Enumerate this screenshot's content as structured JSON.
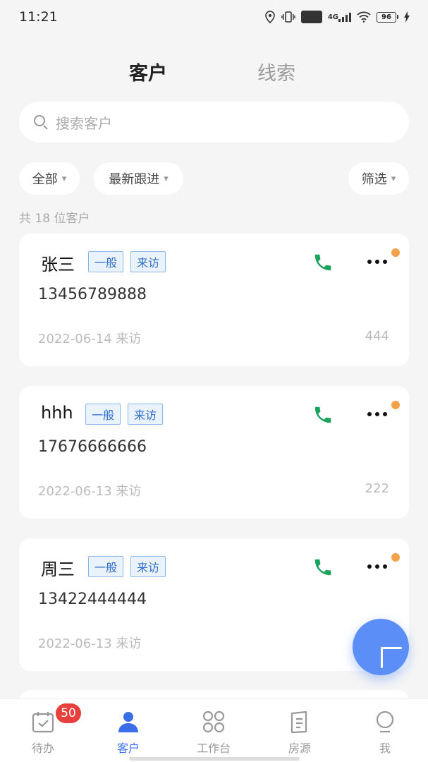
{
  "status": {
    "time": "11:21",
    "hd": "HD",
    "network": "4G",
    "battery": "96"
  },
  "tabs": {
    "customer": "客户",
    "clues": "线索"
  },
  "search": {
    "placeholder": "搜索客户"
  },
  "filters": {
    "all": "全部",
    "latest": "最新跟进",
    "screen": "筛选",
    "caret": "▾"
  },
  "summary": {
    "count_text": "共 18 位客户"
  },
  "customers": [
    {
      "name": "张三",
      "tags": [
        "一般",
        "来访"
      ],
      "phone": "13456789888",
      "date_visit": "2022-06-14 来访",
      "number": "444"
    },
    {
      "name": "hhh",
      "tags": [
        "一般",
        "来访"
      ],
      "phone": "17676666666",
      "date_visit": "2022-06-13 来访",
      "number": "222"
    },
    {
      "name": "周三",
      "tags": [
        "一般",
        "来访"
      ],
      "phone": "13422444444",
      "date_visit": "2022-06-13 来访",
      "number": ""
    }
  ],
  "bottom_nav": {
    "todo": {
      "label": "待办",
      "badge": "50"
    },
    "customer": {
      "label": "客户"
    },
    "workbench": {
      "label": "工作台"
    },
    "house": {
      "label": "房源"
    },
    "me": {
      "label": "我"
    }
  },
  "colors": {
    "accent": "#3a6ee8",
    "fab": "#5b8ff7",
    "phone_green": "#1aa35c",
    "dot": "#f3a24a",
    "badge": "#e8403d"
  },
  "icons": [
    "location-icon",
    "vibrate-icon",
    "wifi-icon",
    "search-icon",
    "phone-icon",
    "more-icon",
    "plus-icon",
    "todo-calendar-icon",
    "customer-person-icon",
    "workbench-grid-icon",
    "house-doc-icon",
    "me-bulb-icon"
  ]
}
